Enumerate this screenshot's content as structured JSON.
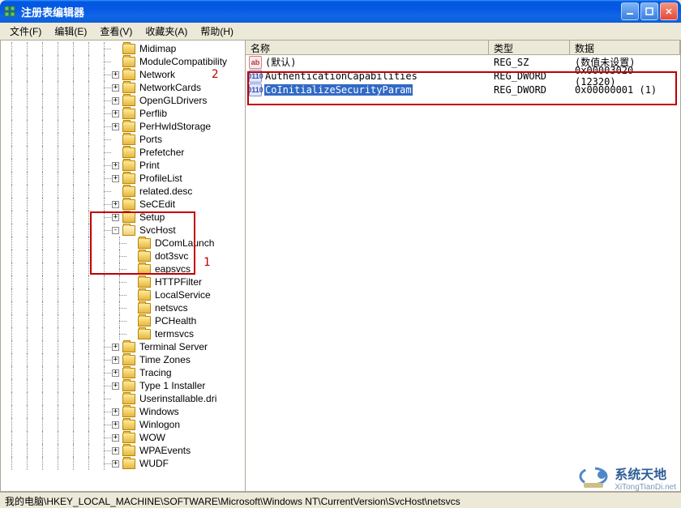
{
  "window": {
    "title": "注册表编辑器"
  },
  "menu": {
    "file": "文件(F)",
    "edit": "编辑(E)",
    "view": "查看(V)",
    "favorites": "收藏夹(A)",
    "help": "帮助(H)"
  },
  "tree": {
    "nodes": [
      {
        "depth": 7,
        "expand": null,
        "label": "Midimap"
      },
      {
        "depth": 7,
        "expand": null,
        "label": "ModuleCompatibility"
      },
      {
        "depth": 7,
        "expand": "+",
        "label": "Network"
      },
      {
        "depth": 7,
        "expand": "+",
        "label": "NetworkCards"
      },
      {
        "depth": 7,
        "expand": "+",
        "label": "OpenGLDrivers"
      },
      {
        "depth": 7,
        "expand": "+",
        "label": "Perflib"
      },
      {
        "depth": 7,
        "expand": "+",
        "label": "PerHwIdStorage"
      },
      {
        "depth": 7,
        "expand": null,
        "label": "Ports"
      },
      {
        "depth": 7,
        "expand": null,
        "label": "Prefetcher"
      },
      {
        "depth": 7,
        "expand": "+",
        "label": "Print"
      },
      {
        "depth": 7,
        "expand": "+",
        "label": "ProfileList"
      },
      {
        "depth": 7,
        "expand": null,
        "label": "related.desc"
      },
      {
        "depth": 7,
        "expand": "+",
        "label": "SeCEdit"
      },
      {
        "depth": 7,
        "expand": "+",
        "label": "Setup"
      },
      {
        "depth": 7,
        "expand": "-",
        "label": "SvcHost",
        "open": true
      },
      {
        "depth": 8,
        "expand": null,
        "label": "DComLaunch"
      },
      {
        "depth": 8,
        "expand": null,
        "label": "dot3svc"
      },
      {
        "depth": 8,
        "expand": null,
        "label": "eapsvcs"
      },
      {
        "depth": 8,
        "expand": null,
        "label": "HTTPFilter"
      },
      {
        "depth": 8,
        "expand": null,
        "label": "LocalService"
      },
      {
        "depth": 8,
        "expand": null,
        "label": "netsvcs"
      },
      {
        "depth": 8,
        "expand": null,
        "label": "PCHealth"
      },
      {
        "depth": 8,
        "expand": null,
        "label": "termsvcs"
      },
      {
        "depth": 7,
        "expand": "+",
        "label": "Terminal Server"
      },
      {
        "depth": 7,
        "expand": "+",
        "label": "Time Zones"
      },
      {
        "depth": 7,
        "expand": "+",
        "label": "Tracing"
      },
      {
        "depth": 7,
        "expand": "+",
        "label": "Type 1 Installer"
      },
      {
        "depth": 7,
        "expand": null,
        "label": "Userinstallable.dri"
      },
      {
        "depth": 7,
        "expand": "+",
        "label": "Windows"
      },
      {
        "depth": 7,
        "expand": "+",
        "label": "Winlogon"
      },
      {
        "depth": 7,
        "expand": "+",
        "label": "WOW"
      },
      {
        "depth": 7,
        "expand": "+",
        "label": "WPAEvents"
      },
      {
        "depth": 7,
        "expand": "+",
        "label": "WUDF"
      }
    ]
  },
  "list": {
    "headers": {
      "name": "名称",
      "type": "类型",
      "data": "数据"
    },
    "rows": [
      {
        "icon": "sz",
        "name": "(默认)",
        "type": "REG_SZ",
        "data": "(数值未设置)",
        "selected": false
      },
      {
        "icon": "dw",
        "name": "AuthenticationCapabilities",
        "type": "REG_DWORD",
        "data": "0x00003020 (12320)",
        "selected": false
      },
      {
        "icon": "dw",
        "name": "CoInitializeSecurityParam",
        "type": "REG_DWORD",
        "data": "0x00000001 (1)",
        "selected": true
      }
    ]
  },
  "annotations": {
    "one": "1",
    "two": "2"
  },
  "statusbar": "我的电脑\\HKEY_LOCAL_MACHINE\\SOFTWARE\\Microsoft\\Windows NT\\CurrentVersion\\SvcHost\\netsvcs",
  "watermark": {
    "main": "系统天地",
    "sub": "XiTongTianDi.net"
  }
}
